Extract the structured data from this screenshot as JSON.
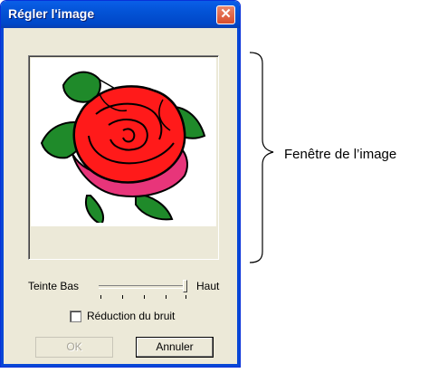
{
  "dialog": {
    "title": "Régler l'image",
    "close_symbol": "✕"
  },
  "image_window": {
    "subject": "rose-illustration"
  },
  "tint_slider": {
    "label_low": "Teinte Bas",
    "label_high": "Haut",
    "value": 1.0
  },
  "noise_reduction": {
    "label": "Réduction du bruit",
    "checked": false
  },
  "buttons": {
    "ok_label": "OK",
    "ok_enabled": false,
    "cancel_label": "Annuler"
  },
  "annotation": {
    "label": "Fenêtre de l’image"
  },
  "colors": {
    "titlebar": "#0353d6",
    "dialog_bg": "#ece9d8",
    "close_button": "#d94d2c",
    "rose_red": "#ff1a1a",
    "rose_pink": "#e8357a",
    "leaf_green": "#1f8a2a"
  }
}
